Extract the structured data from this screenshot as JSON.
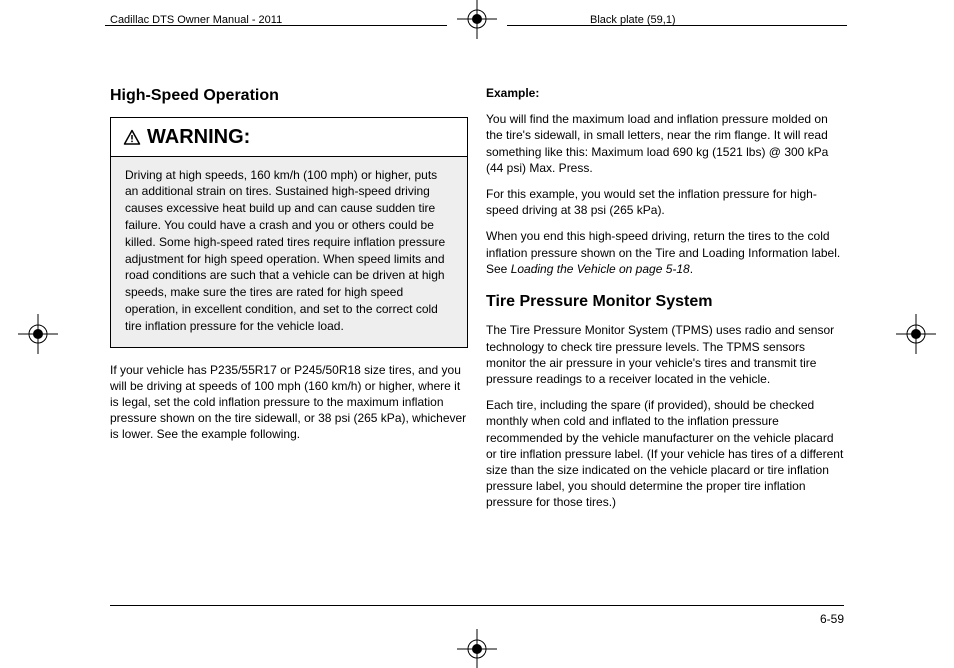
{
  "header": {
    "left": "Cadillac DTS Owner Manual - 2011",
    "right": "Black plate (59,1)"
  },
  "left_col": {
    "h_highspeed": "High-Speed Operation",
    "warning_label": "WARNING:",
    "warning_body": "Driving at high speeds, 160 km/h (100 mph) or higher, puts an additional strain on tires. Sustained high-speed driving causes excessive heat build up and can cause sudden tire failure. You could have a crash and you or others could be killed. Some high-speed rated tires require inflation pressure adjustment for high speed operation. When speed limits and road conditions are such that a vehicle can be driven at high speeds, make sure the tires are rated for high speed operation, in excellent condition, and set to the correct cold tire inflation pressure for the vehicle load.",
    "p_after_warning": "If your vehicle has P235/55R17 or P245/50R18 size tires, and you will be driving at speeds of 100 mph (160 km/h) or higher, where it is legal, set the cold inflation pressure to the maximum inflation pressure shown on the tire sidewall, or 38 psi (265 kPa), whichever is lower. See the example following."
  },
  "right_col": {
    "example_label": "Example:",
    "example_p1": "You will find the maximum load and inflation pressure molded on the tire's sidewall, in small letters, near the rim flange. It will read something like this: Maximum load 690 kg (1521 lbs) @ 300 kPa (44 psi) Max. Press.",
    "example_p2": "For this example, you would set the inflation pressure for high-speed driving at 38 psi (265 kPa).",
    "example_p3a": "When you end this high-speed driving, return the tires to the cold inflation pressure shown on the Tire and Loading Information label. See ",
    "example_p3b_ital": "Loading the Vehicle on page 5‑18",
    "example_p3c": ".",
    "h_tpms": "Tire Pressure Monitor System",
    "tpms_p1": "The Tire Pressure Monitor System (TPMS) uses radio and sensor technology to check tire pressure levels. The TPMS sensors monitor the air pressure in your vehicle's tires and transmit tire pressure readings to a receiver located in the vehicle.",
    "tpms_p2": "Each tire, including the spare (if provided), should be checked monthly when cold and inflated to the inflation pressure recommended by the vehicle manufacturer on the vehicle placard or tire inflation pressure label. (If your vehicle has tires of a different size than the size indicated on the vehicle placard or tire inflation pressure label, you should determine the proper tire inflation pressure for those tires.)"
  },
  "page_number": "6-59"
}
